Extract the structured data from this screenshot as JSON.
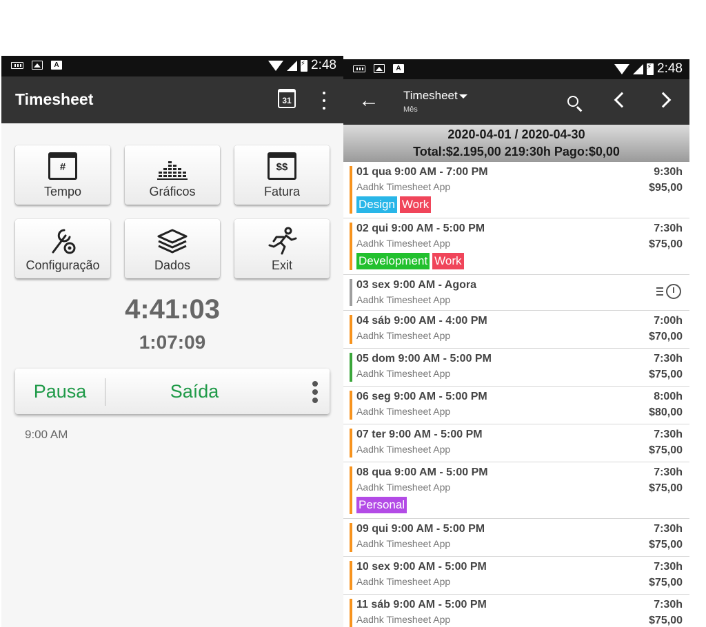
{
  "left": {
    "status": {
      "time": "2:48"
    },
    "appbar": {
      "title": "Timesheet",
      "calendar_icon_text": "31"
    },
    "tiles": [
      {
        "label": "Tempo",
        "icon": "calendar-grid-icon",
        "glyph": "#"
      },
      {
        "label": "Gráficos",
        "icon": "equalizer-chart-icon",
        "glyph": ""
      },
      {
        "label": "Fatura",
        "icon": "calendar-dollar-icon",
        "glyph": "$$"
      },
      {
        "label": "Configuração",
        "icon": "wrench-gear-icon",
        "glyph": "🔧"
      },
      {
        "label": "Dados",
        "icon": "layers-icon",
        "glyph": "◈"
      },
      {
        "label": "Exit",
        "icon": "running-man-icon",
        "glyph": "🏃"
      }
    ],
    "timer_main": "4:41:03",
    "timer_secondary": "1:07:09",
    "actions": {
      "pause": "Pausa",
      "exit": "Saída"
    },
    "start_time": "9:00 AM"
  },
  "right": {
    "status": {
      "time": "2:48"
    },
    "appbar": {
      "title": "Timesheet",
      "subtitle": "Mês"
    },
    "summary": {
      "range": "2020-04-01 / 2020-04-30",
      "totals": "Total:$2.195,00 219:30h Pago:$0,00"
    },
    "entries": [
      {
        "title": "01 qua  9:00 AM - 7:00 PM",
        "client": "Aadhk  Timesheet App",
        "hours": "9:30h",
        "amount": "$95,00",
        "bar_color": "#f7931e",
        "tags": [
          {
            "text": "Design",
            "color": "#29b6e8"
          },
          {
            "text": "Work",
            "color": "#f0455a"
          }
        ]
      },
      {
        "title": "02 qui  9:00 AM - 5:00 PM",
        "client": "Aadhk  Timesheet App",
        "hours": "7:30h",
        "amount": "$75,00",
        "bar_color": "#f7931e",
        "tags": [
          {
            "text": "Development",
            "color": "#22c02e"
          },
          {
            "text": "Work",
            "color": "#f0455a"
          }
        ]
      },
      {
        "title": "03 sex  9:00 AM - Agora",
        "client": "Aadhk  Timesheet App",
        "hours": "",
        "amount": "",
        "bar_color": "#9e9e9e",
        "running": true,
        "tags": []
      },
      {
        "title": "04 sáb  9:00 AM - 4:00 PM",
        "client": "Aadhk  Timesheet App",
        "hours": "7:00h",
        "amount": "$70,00",
        "bar_color": "#f7931e",
        "tags": []
      },
      {
        "title": "05 dom  9:00 AM - 5:00 PM",
        "client": "Aadhk  Timesheet App",
        "hours": "7:30h",
        "amount": "$75,00",
        "bar_color": "#3aa63a",
        "tags": []
      },
      {
        "title": "06 seg  9:00 AM - 5:00 PM",
        "client": "Aadhk  Timesheet App",
        "hours": "8:00h",
        "amount": "$80,00",
        "bar_color": "#f7931e",
        "tags": []
      },
      {
        "title": "07 ter  9:00 AM - 5:00 PM",
        "client": "Aadhk  Timesheet App",
        "hours": "7:30h",
        "amount": "$75,00",
        "bar_color": "#f7931e",
        "tags": []
      },
      {
        "title": "08 qua  9:00 AM - 5:00 PM",
        "client": "Aadhk  Timesheet App",
        "hours": "7:30h",
        "amount": "$75,00",
        "bar_color": "#f7931e",
        "tags": [
          {
            "text": "Personal",
            "color": "#b34be6"
          }
        ]
      },
      {
        "title": "09 qui  9:00 AM - 5:00 PM",
        "client": "Aadhk  Timesheet App",
        "hours": "7:30h",
        "amount": "$75,00",
        "bar_color": "#f7931e",
        "tags": []
      },
      {
        "title": "10 sex  9:00 AM - 5:00 PM",
        "client": "Aadhk  Timesheet App",
        "hours": "7:30h",
        "amount": "$75,00",
        "bar_color": "#f7931e",
        "tags": []
      },
      {
        "title": "11 sáb  9:00 AM - 5:00 PM",
        "client": "Aadhk  Timesheet App",
        "hours": "7:30h",
        "amount": "$75,00",
        "bar_color": "#f7931e",
        "tags": []
      }
    ]
  },
  "colors": {
    "appbar": "#333333",
    "accent_green": "#1f9a48",
    "entry_bar_default": "#f7931e"
  }
}
